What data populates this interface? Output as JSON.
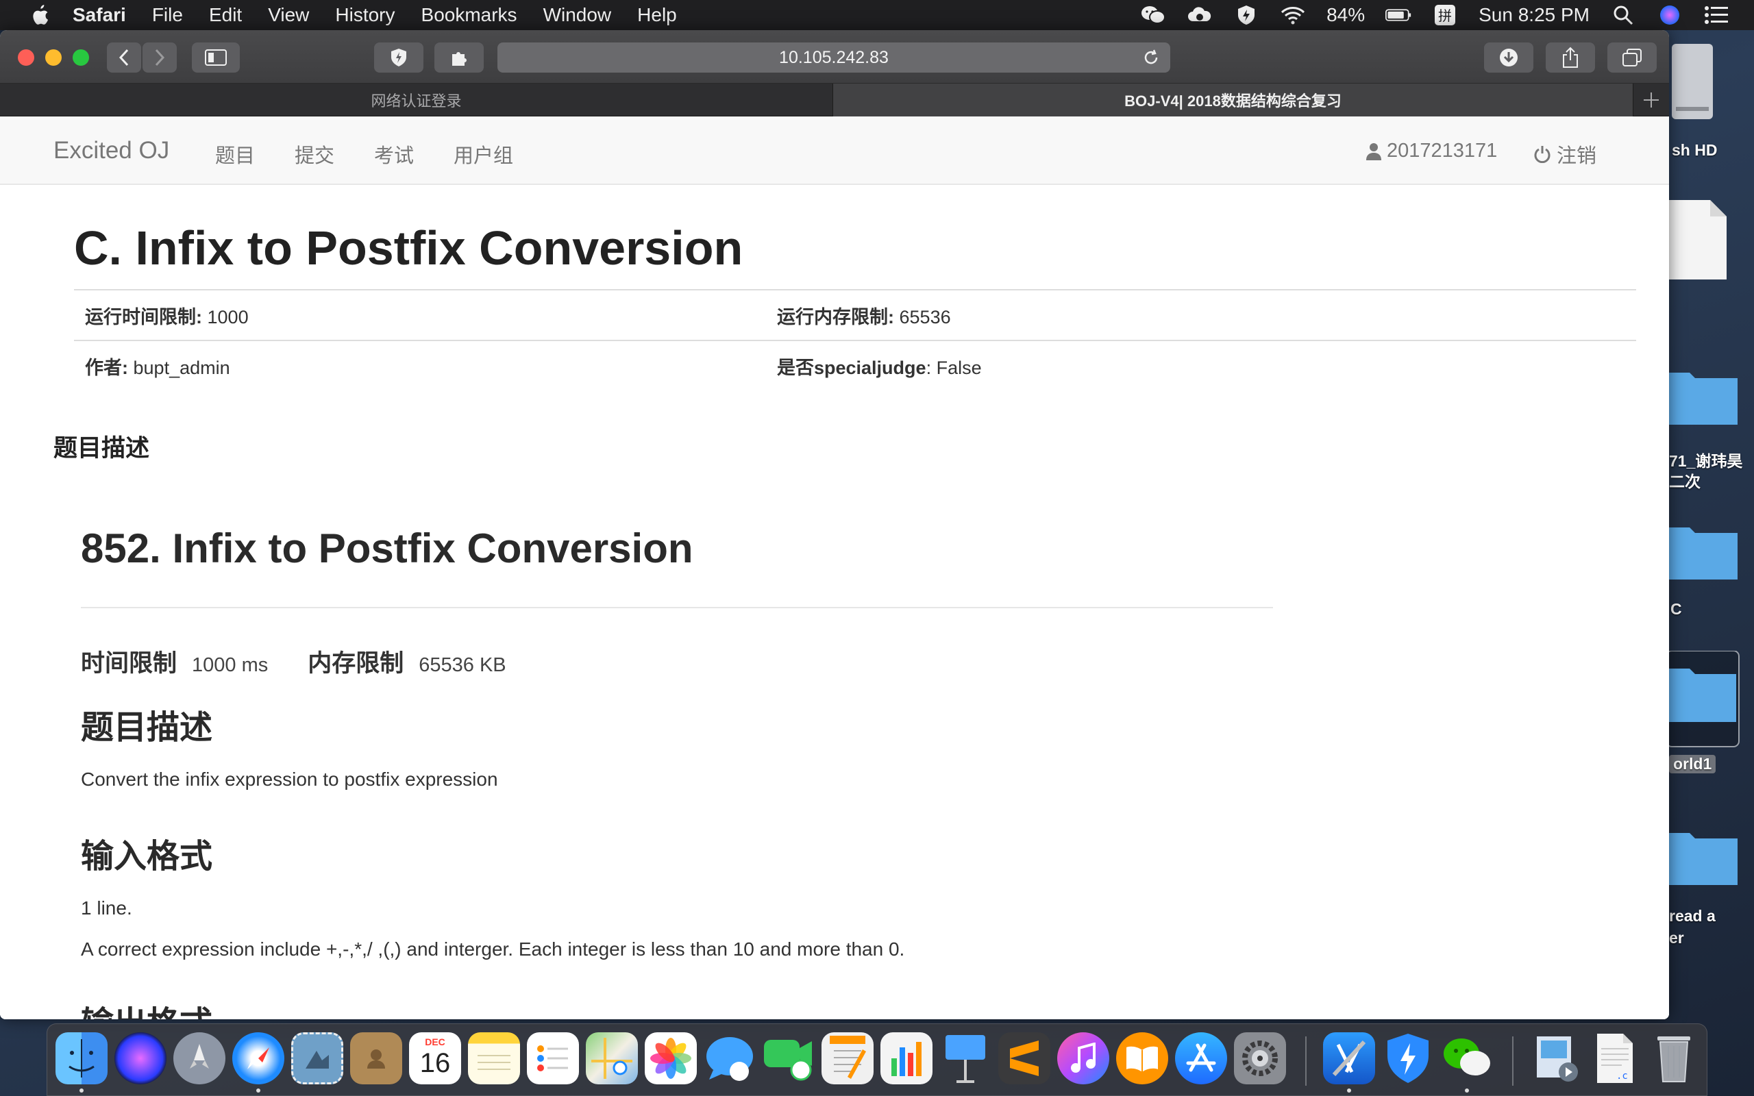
{
  "menubar": {
    "app": "Safari",
    "items": [
      "File",
      "Edit",
      "View",
      "History",
      "Bookmarks",
      "Window",
      "Help"
    ],
    "battery": "84%",
    "clock": "Sun 8:25 PM"
  },
  "browser": {
    "url": "10.105.242.83",
    "tabs": [
      {
        "title": "网络认证登录",
        "active": false
      },
      {
        "title": "BOJ-V4| 2018数据结构综合复习",
        "active": true
      }
    ]
  },
  "site": {
    "brand": "Excited OJ",
    "nav": [
      "题目",
      "提交",
      "考试",
      "用户组"
    ],
    "user": "2017213171",
    "logout": "注销"
  },
  "problem": {
    "title": "C. Infix to Postfix Conversion",
    "meta": {
      "time_label": "运行时间限制:",
      "time_value": "1000",
      "mem_label": "运行内存限制:",
      "mem_value": "65536",
      "author_label": "作者:",
      "author_value": "bupt_admin",
      "special_label_cn": "是否",
      "special_label_en": "specialjudge",
      "special_colon": ":",
      "special_value": "False"
    },
    "section_heading": "题目描述"
  },
  "description": {
    "title": "852. Infix to Postfix Conversion",
    "time_label": "时间限制",
    "time_value": "1000 ms",
    "mem_label": "内存限制",
    "mem_value": "65536 KB",
    "desc_heading": "题目描述",
    "desc_text": "Convert the infix expression to postfix expression",
    "input_heading": "输入格式",
    "input_line1": "1 line.",
    "input_line2": "A correct expression include +,-,*,/ ,(,) and interger. Each integer is less than 10 and more than 0.",
    "output_heading": "输出格式"
  },
  "desktop": {
    "labels": [
      "sh HD",
      "71_谢玮昊",
      "二次",
      "C",
      "orld1",
      "read a",
      "er"
    ]
  },
  "dock": {
    "calendar_month": "DEC",
    "calendar_day": "16"
  }
}
